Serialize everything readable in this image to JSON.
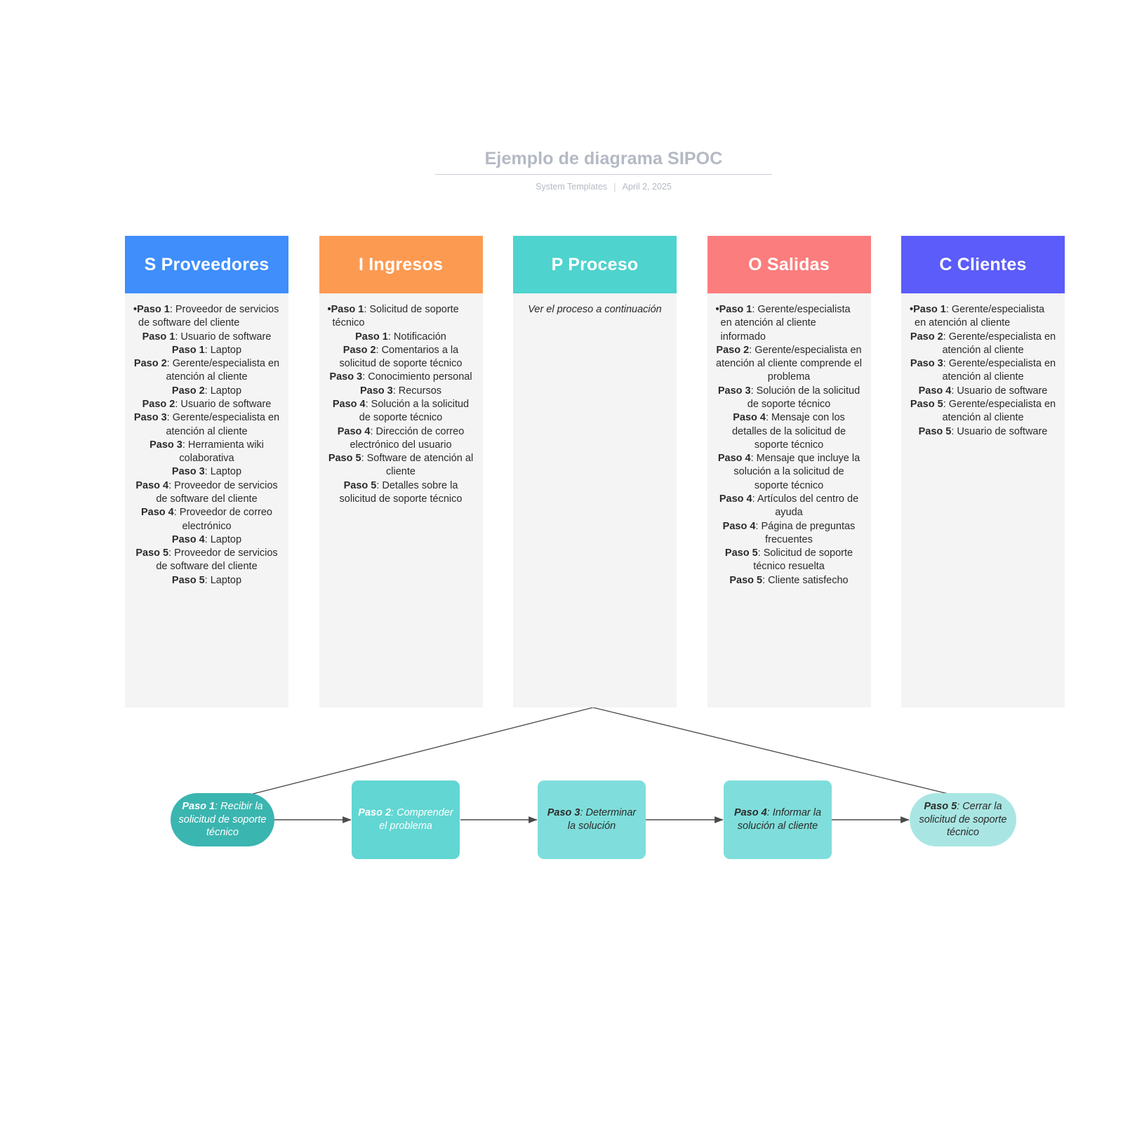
{
  "header": {
    "title": "Ejemplo de diagrama SIPOC",
    "author": "System Templates",
    "separator": "|",
    "date": "April 2, 2025"
  },
  "colors": {
    "suppliers": "#3f8efc",
    "inputs": "#fd9a52",
    "process": "#4ed3ce",
    "outputs": "#fc7d7d",
    "customers": "#5b5cfa",
    "panel_bg": "#f4f4f4",
    "node_dark_teal": "#3bb5b0",
    "node_mid_teal": "#62d6d2",
    "node_light_teal": "#a9e6e3",
    "connector": "#4a4a4a",
    "title_gray": "#b4b9c4"
  },
  "columns": [
    {
      "key": "suppliers",
      "letter": "S",
      "title": "S Proveedores",
      "items": [
        {
          "step": "Paso 1",
          "text": "Proveedor de servicios de software del cliente"
        },
        {
          "step": "Paso 1",
          "text": "Usuario de software"
        },
        {
          "step": "Paso 1",
          "text": "Laptop"
        },
        {
          "step": "Paso 2",
          "text": "Gerente/especialista en atención al cliente"
        },
        {
          "step": "Paso 2",
          "text": "Laptop"
        },
        {
          "step": "Paso 2",
          "text": "Usuario de software"
        },
        {
          "step": "Paso 3",
          "text": "Gerente/especialista en atención al cliente"
        },
        {
          "step": "Paso 3",
          "text": "Herramienta wiki colaborativa"
        },
        {
          "step": "Paso 3",
          "text": "Laptop"
        },
        {
          "step": "Paso 4",
          "text": "Proveedor de servicios de software del cliente"
        },
        {
          "step": "Paso 4",
          "text": "Proveedor de correo electrónico"
        },
        {
          "step": "Paso 4",
          "text": "Laptop"
        },
        {
          "step": "Paso 5",
          "text": "Proveedor de servicios de software del cliente"
        },
        {
          "step": "Paso 5",
          "text": "Laptop"
        }
      ]
    },
    {
      "key": "inputs",
      "letter": "I",
      "title": "I Ingresos",
      "items": [
        {
          "step": "Paso 1",
          "text": "Solicitud de soporte técnico"
        },
        {
          "step": "Paso 1",
          "text": "Notificación"
        },
        {
          "step": "Paso 2",
          "text": "Comentarios a la solicitud de soporte técnico"
        },
        {
          "step": "Paso 3",
          "text": "Conocimiento personal"
        },
        {
          "step": "Paso 3",
          "text": "Recursos"
        },
        {
          "step": "Paso 4",
          "text": "Solución a la solicitud de soporte técnico"
        },
        {
          "step": "Paso 4",
          "text": "Dirección de correo electrónico del usuario"
        },
        {
          "step": "Paso 5",
          "text": "Software de atención al cliente"
        },
        {
          "step": "Paso 5",
          "text": "Detalles sobre la solicitud de soporte técnico"
        }
      ]
    },
    {
      "key": "process",
      "letter": "P",
      "title": "P Proceso",
      "note": "Ver el proceso a continuación",
      "items": []
    },
    {
      "key": "outputs",
      "letter": "O",
      "title": "O Salidas",
      "items": [
        {
          "step": "Paso 1",
          "text": "Gerente/especialista en atención al cliente informado"
        },
        {
          "step": "Paso 2",
          "text": "Gerente/especialista en atención al cliente comprende el problema"
        },
        {
          "step": "Paso 3",
          "text": "Solución de la solicitud de soporte técnico"
        },
        {
          "step": "Paso 4",
          "text": "Mensaje con los detalles de la solicitud de soporte técnico"
        },
        {
          "step": "Paso 4",
          "text": "Mensaje que incluye la solución a la solicitud de soporte técnico"
        },
        {
          "step": "Paso 4",
          "text": "Artículos del centro de ayuda"
        },
        {
          "step": "Paso 4",
          "text": "Página de preguntas frecuentes"
        },
        {
          "step": "Paso 5",
          "text": "Solicitud de soporte técnico resuelta"
        },
        {
          "step": "Paso 5",
          "text": "Cliente satisfecho"
        }
      ]
    },
    {
      "key": "customers",
      "letter": "C",
      "title": "C Clientes",
      "items": [
        {
          "step": "Paso 1",
          "text": "Gerente/especialista en atención al cliente"
        },
        {
          "step": "Paso 2",
          "text": "Gerente/especialista en atención al cliente"
        },
        {
          "step": "Paso 3",
          "text": "Gerente/especialista en atención al cliente"
        },
        {
          "step": "Paso 4",
          "text": "Usuario de software"
        },
        {
          "step": "Paso 5",
          "text": "Gerente/especialista en atención al cliente"
        },
        {
          "step": "Paso 5",
          "text": "Usuario de software"
        }
      ]
    }
  ],
  "flow": {
    "nodes": [
      {
        "step": "Paso 1",
        "text": "Recibir la solicitud de soporte técnico",
        "shape": "pill",
        "fill": "#3bb5b0",
        "text_color": "#ffffff"
      },
      {
        "step": "Paso 2",
        "text": "Comprender el problema",
        "shape": "rect",
        "fill": "#62d6d2",
        "text_color": "#ffffff"
      },
      {
        "step": "Paso 3",
        "text": "Determinar la solución",
        "shape": "rect",
        "fill": "#7fdedb",
        "text_color": "#2b2b2b"
      },
      {
        "step": "Paso 4",
        "text": "Informar la solución al cliente",
        "shape": "rect",
        "fill": "#7fdedb",
        "text_color": "#2b2b2b"
      },
      {
        "step": "Paso 5",
        "text": "Cerrar la solicitud de soporte técnico",
        "shape": "pill",
        "fill": "#a9e6e3",
        "text_color": "#2b2b2b"
      }
    ]
  }
}
